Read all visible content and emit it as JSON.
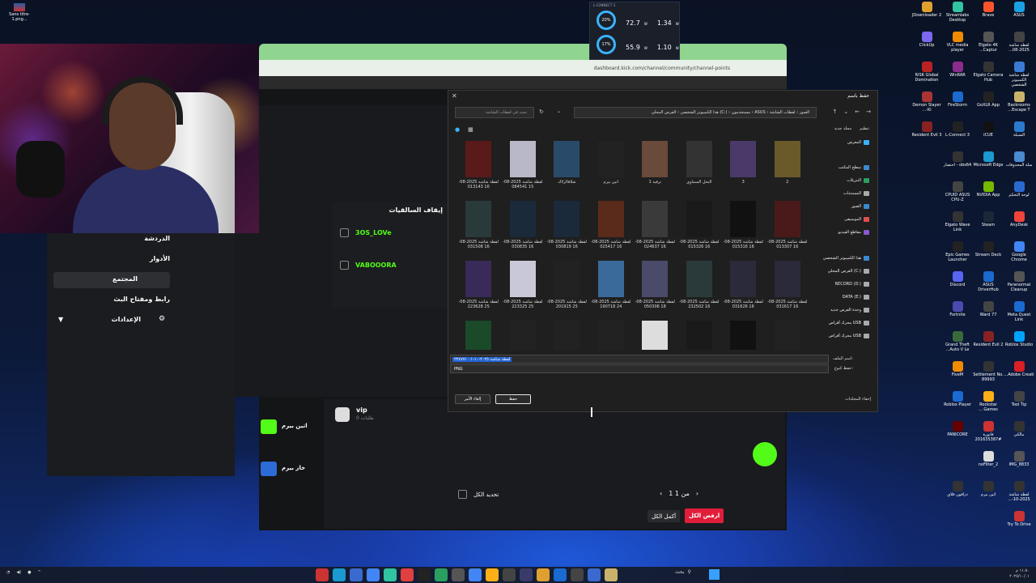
{
  "desktop_icons": [
    {
      "label": "ASUS",
      "color": "#1ba1e2"
    },
    {
      "label": "Brave",
      "color": "#fb542b"
    },
    {
      "label": "Streamlabs Desktop",
      "color": "#31c3a2"
    },
    {
      "label": "JDownloader 2",
      "color": "#e0a030"
    },
    {
      "label": "لقطة شاشة 2025-08...",
      "color": "#444"
    },
    {
      "label": "Elgato 4K Captur...",
      "color": "#555"
    },
    {
      "label": "VLC media player",
      "color": "#f08a00"
    },
    {
      "label": "ClickUp",
      "color": "#7b68ee"
    },
    {
      "label": "لقطة شاشة الكمبيوتر الشخصي",
      "color": "#3a7bd5"
    },
    {
      "label": "Elgato Camera Hub",
      "color": "#333"
    },
    {
      "label": "WinRAR",
      "color": "#8b2b8b"
    },
    {
      "label": "RISK Global Domination",
      "color": "#b22"
    },
    {
      "label": "Backrooms Escape T...",
      "color": "#c9b36b"
    },
    {
      "label": "GoXLR App",
      "color": "#222"
    },
    {
      "label": "FireStorm",
      "color": "#1a6ad0"
    },
    {
      "label": "Demon Slayer -Ki...",
      "color": "#a33"
    },
    {
      "label": "الشبكة",
      "color": "#2a7ad0"
    },
    {
      "label": "iCUE",
      "color": "#111"
    },
    {
      "label": "L-Connect 3",
      "color": "#222"
    },
    {
      "label": "Resident Evil 3",
      "color": "#822"
    },
    {
      "label": "سلة المحذوفات",
      "color": "#4a8ad0"
    },
    {
      "label": "Microsoft Edge",
      "color": "#1a9ad0"
    },
    {
      "label": "obs64 - اختصار",
      "color": "#333"
    },
    {
      "label": "",
      "color": "transparent"
    },
    {
      "label": "لوحة التحكم",
      "color": "#2a6ad0"
    },
    {
      "label": "NVIDIA App",
      "color": "#76b900"
    },
    {
      "label": "CPUID ASUS CPU-Z",
      "color": "#444"
    },
    {
      "label": "",
      "color": "transparent"
    },
    {
      "label": "AnyDesk",
      "color": "#ef443b"
    },
    {
      "label": "Steam",
      "color": "#1b2838"
    },
    {
      "label": "Elgato Wave Link",
      "color": "#333"
    },
    {
      "label": "",
      "color": "transparent"
    },
    {
      "label": "Google Chrome",
      "color": "#4285f4"
    },
    {
      "label": "Stream Deck",
      "color": "#222"
    },
    {
      "label": "Epic Games Launcher",
      "color": "#222"
    },
    {
      "label": "",
      "color": "transparent"
    },
    {
      "label": "Paranormal Cleanup",
      "color": "#555"
    },
    {
      "label": "ASUS DriverHub",
      "color": "#1a6ad0"
    },
    {
      "label": "Discord",
      "color": "#5865f2"
    },
    {
      "label": "",
      "color": "transparent"
    },
    {
      "label": "Meta Quest Link",
      "color": "#1a6ad0"
    },
    {
      "label": "Ward 77",
      "color": "#444"
    },
    {
      "label": "Fortnite",
      "color": "#4a4ab0"
    },
    {
      "label": "",
      "color": "transparent"
    },
    {
      "label": "Roblox Studio",
      "color": "#00a2ff"
    },
    {
      "label": "Resident Evil 2",
      "color": "#822"
    },
    {
      "label": "Grand Theft Auto V Le...",
      "color": "#3a6a3a"
    },
    {
      "label": "",
      "color": "transparent"
    },
    {
      "label": "Adobe Creati...",
      "color": "#da1f26"
    },
    {
      "label": "Settlement No. 89993",
      "color": "#333"
    },
    {
      "label": "FiveM",
      "color": "#f08a00"
    },
    {
      "label": "",
      "color": "transparent"
    },
    {
      "label": "Tool Tip",
      "color": "#444"
    },
    {
      "label": "Rockstar Games ...",
      "color": "#fcaf17"
    },
    {
      "label": "Roblox Player",
      "color": "#1a6ad0"
    },
    {
      "label": "",
      "color": "transparent"
    },
    {
      "label": "مالكي",
      "color": "#333"
    },
    {
      "label": "فاتورة #201635387",
      "color": "#c33"
    },
    {
      "label": "PANICORE",
      "color": "#600"
    },
    {
      "label": "",
      "color": "transparent"
    },
    {
      "label": "IMG_8833",
      "color": "#555"
    },
    {
      "label": "noFilter_2",
      "color": "#ddd"
    },
    {
      "label": "",
      "color": "transparent"
    },
    {
      "label": "",
      "color": "transparent"
    },
    {
      "label": "لقطة شاشة 2025-10-...",
      "color": "#333"
    },
    {
      "label": "اتين بيرم",
      "color": "#333"
    },
    {
      "label": "درافون فلاي",
      "color": "#333"
    },
    {
      "label": "",
      "color": "transparent"
    },
    {
      "label": "Try To Drive",
      "color": "#c33"
    }
  ],
  "left_desktop_icon": "Sans titre-1.png...",
  "browser": {
    "url": "dashboard.kick.com/channel/community/channel-points"
  },
  "hw_widget": {
    "title": "L-CONNECT 3",
    "row1": {
      "pct": "20%",
      "val1": "72.7",
      "unit1": "W",
      "val2": "1.34",
      "unit2": "W"
    },
    "row2": {
      "pct": "17%",
      "val1": "55.9",
      "unit1": "W",
      "val2": "1.10",
      "unit2": "W"
    }
  },
  "kick_menu": {
    "items": [
      "الدردشة",
      "الأدوار",
      "المجتمع",
      "رابط ومفتاح البث",
      "الإعدادات"
    ],
    "active": "المجتمع"
  },
  "hunt": {
    "title": "إيقاف السالقيات",
    "users": [
      "3OS_LOVe",
      "VABOOORA"
    ]
  },
  "rewards": {
    "green_label": "اتين بيرم",
    "blue_label": "خاز بيرم",
    "vip_title": "vip",
    "vip_sub": "0 طلبات"
  },
  "bottom": {
    "select_all": "تحديد الكل",
    "pager": "1 من 1",
    "accept_all": "أكمل الكل",
    "reject_all": "ارفض الكل"
  },
  "dialog": {
    "title": "حفظ باسم",
    "breadcrumb": "هذا الكمبيوتر الشخصي › القرص المحلي (C:) › مستخدمون › ASUS › الصور › لقطات الشاشة",
    "search_placeholder": "بحث في لقطات الشاشة",
    "cmd_organize": "تنظيم",
    "cmd_new_folder": "مجلد جديد",
    "nav": [
      {
        "label": "المعرض",
        "color": "#3ab3ff"
      },
      {
        "label": "سطح المكتب",
        "color": "#3a8ad0"
      },
      {
        "label": "التنزيلات",
        "color": "#2aa060"
      },
      {
        "label": "المستندات",
        "color": "#aaa"
      },
      {
        "label": "الصور",
        "color": "#3a8ad0"
      },
      {
        "label": "الموسيقى",
        "color": "#e05050"
      },
      {
        "label": "مقاطع الفيديو",
        "color": "#8a5ad0"
      },
      {
        "label": "هذا الكمبيوتر الشخصي",
        "color": "#3a8ad0"
      },
      {
        "label": "القرص المحلي (C:)",
        "color": "#aaa"
      },
      {
        "label": "RECORD (D:)",
        "color": "#aaa"
      },
      {
        "label": "DATA (E:)",
        "color": "#aaa"
      },
      {
        "label": "وحدة القرص جديد",
        "color": "#aaa"
      },
      {
        "label": "محرك أقراص USB",
        "color": "#aaa"
      },
      {
        "label": "محرك أقراص USB",
        "color": "#aaa"
      }
    ],
    "files": [
      {
        "cap": "لقطة شاشة 2025-08-16 013143",
        "color": "#5a1a1a"
      },
      {
        "cap": "لقطة شاشة 2025-08-15 084541",
        "color": "#b8b8c8"
      },
      {
        "cap": "شلاقالزلاك",
        "color": "#2a4a6a"
      },
      {
        "cap": "اتين بيرم",
        "color": "#222"
      },
      {
        "cap": "ترقية 1",
        "color": "#6a4a3a"
      },
      {
        "cap": "التحل السماوي",
        "color": "#333"
      },
      {
        "cap": "3",
        "color": "#4a3a6a"
      },
      {
        "cap": "2",
        "color": "#6a5a2a"
      },
      {
        "cap": "لقطة شاشة 2025-08-16 031508",
        "color": "#2a3a3a"
      },
      {
        "cap": "لقطة شاشة 2025-08-16 030835",
        "color": "#1a2a3a"
      },
      {
        "cap": "لقطة شاشة 2025-08-16 030819",
        "color": "#1a2a3a"
      },
      {
        "cap": "لقطة شاشة 2025-08-16 025417",
        "color": "#5a2a1a"
      },
      {
        "cap": "لقطة شاشة 2025-08-16 024637",
        "color": "#3a3a3a"
      },
      {
        "cap": "لقطة شاشة 2025-08-16 015326",
        "color": "#1a1a1a"
      },
      {
        "cap": "لقطة شاشة 2025-08-16 015316",
        "color": "#111"
      },
      {
        "cap": "لقطة شاشة 2025-08-16 013307",
        "color": "#4a1a1a"
      },
      {
        "cap": "لقطة شاشة 2025-08-25 223628",
        "color": "#3a2a5a"
      },
      {
        "cap": "لقطة شاشة 2025-08-25 223325",
        "color": "#c8c8d8"
      },
      {
        "cap": "لقطة شاشة 2025-08-25 201915",
        "color": "#222"
      },
      {
        "cap": "لقطة شاشة 2025-08-24 190718",
        "color": "#3a6a9a"
      },
      {
        "cap": "لقطة شاشة 2025-08-18 050306",
        "color": "#4a4a6a"
      },
      {
        "cap": "لقطة شاشة 2025-08-16 232502",
        "color": "#2a3a3a"
      },
      {
        "cap": "لقطة شاشة 2025-08-16 031626",
        "color": "#2a2a3a"
      },
      {
        "cap": "لقطة شاشة 2025-08-16 031617",
        "color": "#2a2a3a"
      },
      {
        "cap": "",
        "color": "#1a4a2a"
      },
      {
        "cap": "",
        "color": "#222"
      },
      {
        "cap": "",
        "color": "#222"
      },
      {
        "cap": "",
        "color": "#222"
      },
      {
        "cap": "",
        "color": "#ddd"
      },
      {
        "cap": "",
        "color": "#1a1a1a"
      },
      {
        "cap": "",
        "color": "#111"
      },
      {
        "cap": "",
        "color": "#222"
      }
    ],
    "file_name": "لقطة شاشة ٢٠٢٥-١٠-٠١ ٢٣٤٧٧١",
    "file_name_label": "اسم الملف:",
    "save_type": "PNG",
    "save_type_label": "حفظ كنوع:",
    "save_button": "حفظ",
    "cancel_button": "إلغاء الأمر",
    "hide_folders": "إخفاء المجلدات"
  },
  "taskbar": {
    "search": "بحث",
    "time": "١١:٥٠ م",
    "date": "٢٠٢٥/١٠/٠١"
  }
}
